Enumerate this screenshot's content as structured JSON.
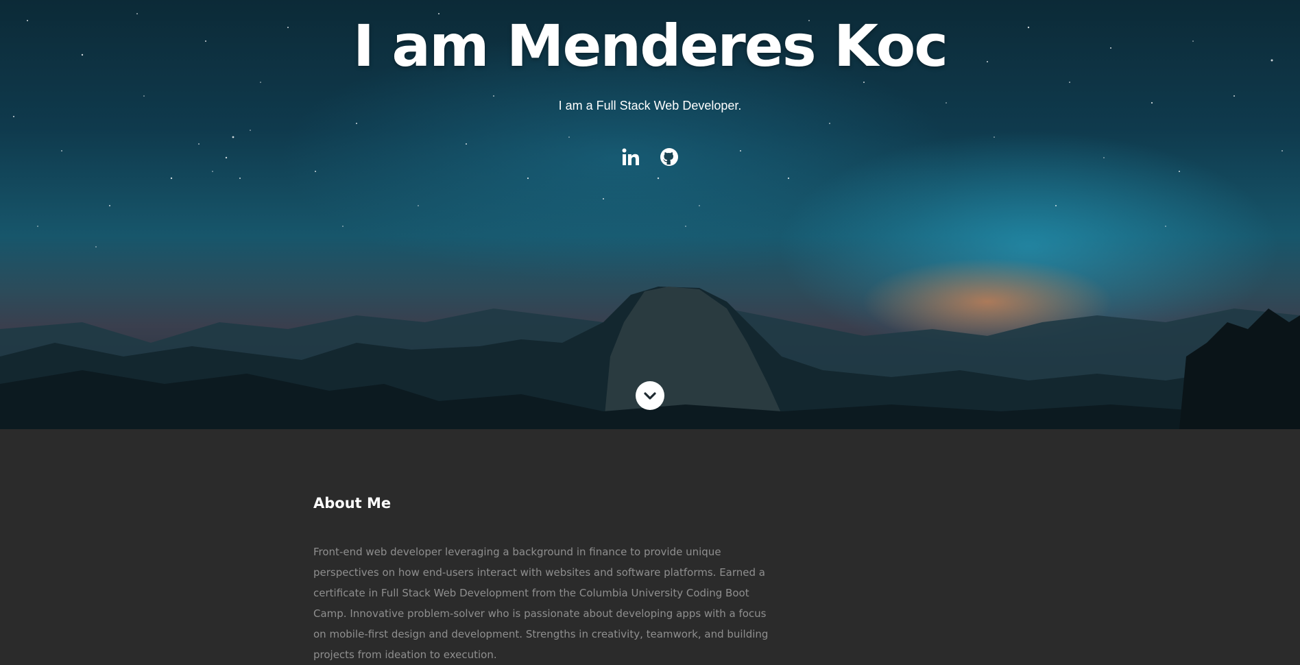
{
  "hero": {
    "title": "I am Menderes Koc",
    "subtitle": "I am a Full Stack Web Developer.",
    "social": [
      {
        "name": "linkedin",
        "icon": "linkedin-icon"
      },
      {
        "name": "github",
        "icon": "github-icon"
      }
    ],
    "scroll_icon": "chevron-down-icon"
  },
  "about": {
    "title": "About Me",
    "text": "Front-end web developer leveraging a background in finance to provide unique perspectives on how end-users interact with websites and software platforms. Earned a certificate in Full Stack Web Development from the Columbia University Coding Boot Camp. Innovative problem-solver who is passionate about developing apps with a focus on mobile-first design and development. Strengths in creativity, teamwork, and building projects from ideation to execution."
  },
  "colors": {
    "about_bg": "#2b2b2b",
    "about_text": "#8f8f8f",
    "hero_text": "#ffffff"
  }
}
